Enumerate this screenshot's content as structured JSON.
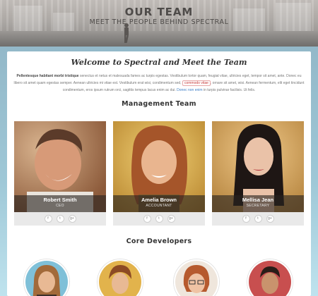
{
  "hero": {
    "title": "OUR TEAM",
    "subtitle": "MEET THE PEOPLE BEHIND SPECTRAL"
  },
  "welcome": {
    "heading": "Welcome to Spectral and Meet the Team",
    "lead_bold": "Pellentesque habitant morbi tristique",
    "text_1": " senectus et netus et malesuada fames ac turpis egestas. Vestibulum tortor quam, feugiat vitae, ultricies eget, tempor sit amet, ante. Donec eu libero sit amet quam egestas semper. Aenean ultricies mi vitae est. Vestibulum erat wisi, condimentum sed,",
    "highlight": "commodo vitae",
    "text_2": ", ornare sit amet, wisi. Aenean fermentum, elit eget tincidunt condimentum, eros ipsum rutrum orci, sagittis tempus lacus enim ac dui.",
    "link_text": "Donec non enim",
    "text_3": " in turpis pulvinar facilisis. Ut felis."
  },
  "management": {
    "title": "Management Team",
    "members": [
      {
        "name": "Robert Smith",
        "role": "CEO"
      },
      {
        "name": "Amelia Brown",
        "role": "ACCOUNTANT"
      },
      {
        "name": "Mellisa Jean",
        "role": "SECRETARY"
      }
    ],
    "social": [
      "f",
      "t",
      "g+"
    ]
  },
  "developers": {
    "title": "Core Developers"
  },
  "colors": {
    "page_bg": "#9ec7d6",
    "card_bg": "#ffffff",
    "name_bar": "#282421",
    "highlight": "#c83a3a",
    "link": "#3f7fc6"
  }
}
